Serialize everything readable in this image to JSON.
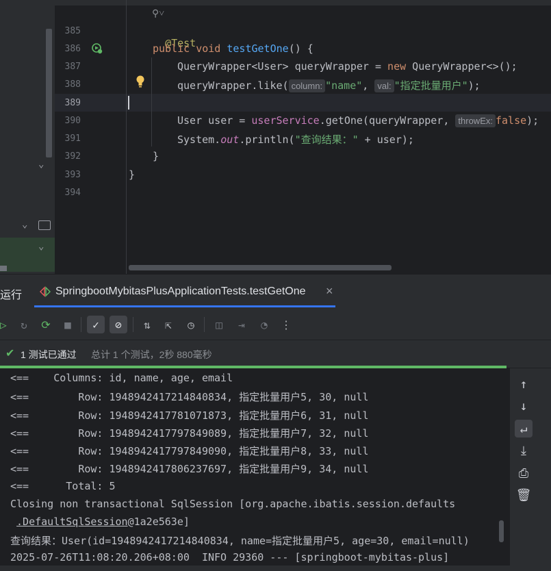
{
  "editor": {
    "collapse_glyph": "⚲˅",
    "lines": [
      {
        "num": "385"
      },
      {
        "num": "386"
      },
      {
        "num": "387"
      },
      {
        "num": "388"
      },
      {
        "num": "389"
      },
      {
        "num": "390"
      },
      {
        "num": "391"
      },
      {
        "num": "392"
      },
      {
        "num": "393"
      },
      {
        "num": "394"
      }
    ],
    "code": {
      "l385_ann": "@Test",
      "l386_kw": "public void ",
      "l386_fn": "testGetOne",
      "l386_rest": "() {",
      "l387_a": "QueryWrapper<User> queryWrapper = ",
      "l387_kw": "new",
      "l387_b": " QueryWrapper<>();",
      "l388_a": "queryWrapper.like(",
      "l388_hint1": "column:",
      "l388_s1": "\"name\"",
      "l388_c": ", ",
      "l388_hint2": "val:",
      "l388_s2": "\"指定批量用户\"",
      "l388_d": ");",
      "l390_a": "User user = ",
      "l390_fld": "userService",
      "l390_b": ".getOne(queryWrapper, ",
      "l390_hint": "throwEx:",
      "l390_kw": "false",
      "l390_c": ");",
      "l391_a": "System.",
      "l391_it": "out",
      "l391_b": ".println(",
      "l391_s": "\"查询结果：\"",
      "l391_c": " + user);",
      "l392": "}",
      "l393": "}"
    }
  },
  "tool": {
    "run_label": "运行",
    "tab_label": "SpringbootMybitasPlusApplicationTests.testGetOne",
    "close_glyph": "×",
    "status_passed": "1 测试已通过",
    "status_summary": "总计 1 个测试，2秒 880毫秒"
  },
  "console": {
    "lines": [
      "<==    Columns: id, name, age, email",
      "<==        Row: 1948942417214840834, 指定批量用户5, 30, null",
      "<==        Row: 1948942417781071873, 指定批量用户6, 31, null",
      "<==        Row: 1948942417797849089, 指定批量用户7, 32, null",
      "<==        Row: 1948942417797849090, 指定批量用户8, 33, null",
      "<==        Row: 1948942417806237697, 指定批量用户9, 34, null",
      "<==      Total: 5",
      "Closing non transactional SqlSession [org.apache.ibatis.session.defaults",
      " .DefaultSqlSession@1a2e563e]",
      "查询结果：User(id=1948942417214840834, name=指定批量用户5, age=30, email=null)",
      "2025-07-26T11:08:20.206+08:00  INFO 29360 --- [springboot-mybitas-plus]"
    ],
    "line9_prefix": " ",
    "line9_link": ".DefaultSqlSession",
    "line9_rest": "@1a2e563e]"
  },
  "colors": {
    "accent": "#3574f0",
    "pass": "#5fb865",
    "keyword": "#cf8e6d",
    "string": "#6aab73",
    "function": "#56a8f5"
  }
}
